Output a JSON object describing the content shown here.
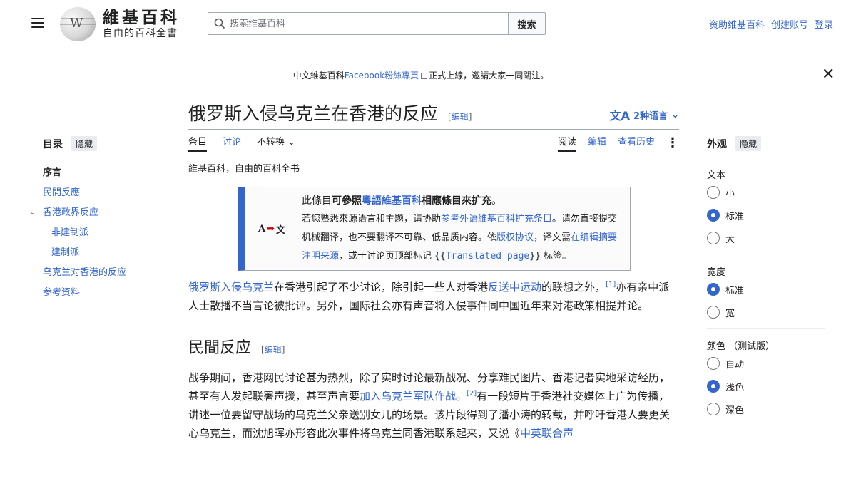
{
  "header": {
    "logo_title": "維基百科",
    "logo_subtitle": "自由的百科全書",
    "search_placeholder": "搜索维基百科",
    "search_button": "搜索",
    "user_links": [
      "资助维基百科",
      "创建账号",
      "登录"
    ]
  },
  "notice": {
    "pre": "中文維基百科",
    "link": "Facebook粉絲專頁",
    "post": "正式上線，邀請大家一同關注。"
  },
  "toc": {
    "title": "目录",
    "hide": "隐藏",
    "items": [
      {
        "label": "序言"
      },
      {
        "label": "民間反應"
      },
      {
        "label": "香港政界反应"
      },
      {
        "label": "非建制派"
      },
      {
        "label": "建制派"
      },
      {
        "label": "乌克兰对香港的反应"
      },
      {
        "label": "参考资料"
      }
    ]
  },
  "article": {
    "title": "俄罗斯入侵乌克兰在香港的反应",
    "edit": "编辑",
    "languages": "2种语言",
    "tabs_left": [
      "条目",
      "讨论",
      "不转换"
    ],
    "tabs_right": [
      "阅读",
      "编辑",
      "查看历史"
    ],
    "tagline": "維基百科，自由的百科全书",
    "ambox": {
      "icon_left": "A",
      "icon_right": "文",
      "h1": "此條目",
      "h2": "可參照",
      "h3": "粵語維基百科",
      "h4": "相應條目來扩充",
      "h5": "。",
      "l1": "若您熟悉來源语言和主题，请协助",
      "l2": "参考外语維基百科扩充条目",
      "l3": "。请勿直接提交机械翻译，也不要翻译不可靠、低品质内容。依",
      "l4": "版权协议",
      "l5": "，译文需",
      "l6": "在编辑摘要注明来源",
      "l7": "，或于讨论页顶部标记",
      "code1": "{{",
      "code2": "Translated page",
      "code3": "}}",
      "l8": "标签。"
    },
    "p1": {
      "a1": "俄罗斯入侵乌克兰",
      "t1": "在香港引起了不少讨论，除引起一些人对香港",
      "a2": "反送中运动",
      "t2": "的联想之外，",
      "ref": "[1]",
      "t3": "亦有亲中派人士散播不当言论被批评。另外，国际社会亦有声音将入侵事件同中国近年来对港政策相提并论。"
    },
    "h2": "民間反应",
    "p2": {
      "t1": "战争期间，香港网民讨论甚为热烈，除了实时讨论最新战况、分享难民图片、香港记者实地采访经历，甚至有人发起联署声援，甚至声言要",
      "a1": "加入乌克兰军队作战",
      "t2": "。",
      "ref": "[2]",
      "t3": "有一段短片于香港社交媒体上广为传播，讲述一位要留守战场的乌克兰父亲送别女儿的场景。该片段得到了潘小涛的转载，并呼吁香港人要更关心乌克兰，而沈旭晖亦形容此次事件将乌克兰同香港联系起来，又说《",
      "a2": "中英联合声"
    }
  },
  "appearance": {
    "title": "外观",
    "hide": "隐藏",
    "text_label": "文本",
    "text_options": [
      "小",
      "标准",
      "大"
    ],
    "text_selected": "标准",
    "width_label": "宽度",
    "width_options": [
      "标准",
      "宽"
    ],
    "width_selected": "标准",
    "color_label": "颜色 （测试版）",
    "color_options": [
      "自动",
      "浅色",
      "深色"
    ],
    "color_selected": "浅色"
  },
  "colors": {
    "link": "#3366cc",
    "accent": "#36c",
    "text": "#202122"
  }
}
